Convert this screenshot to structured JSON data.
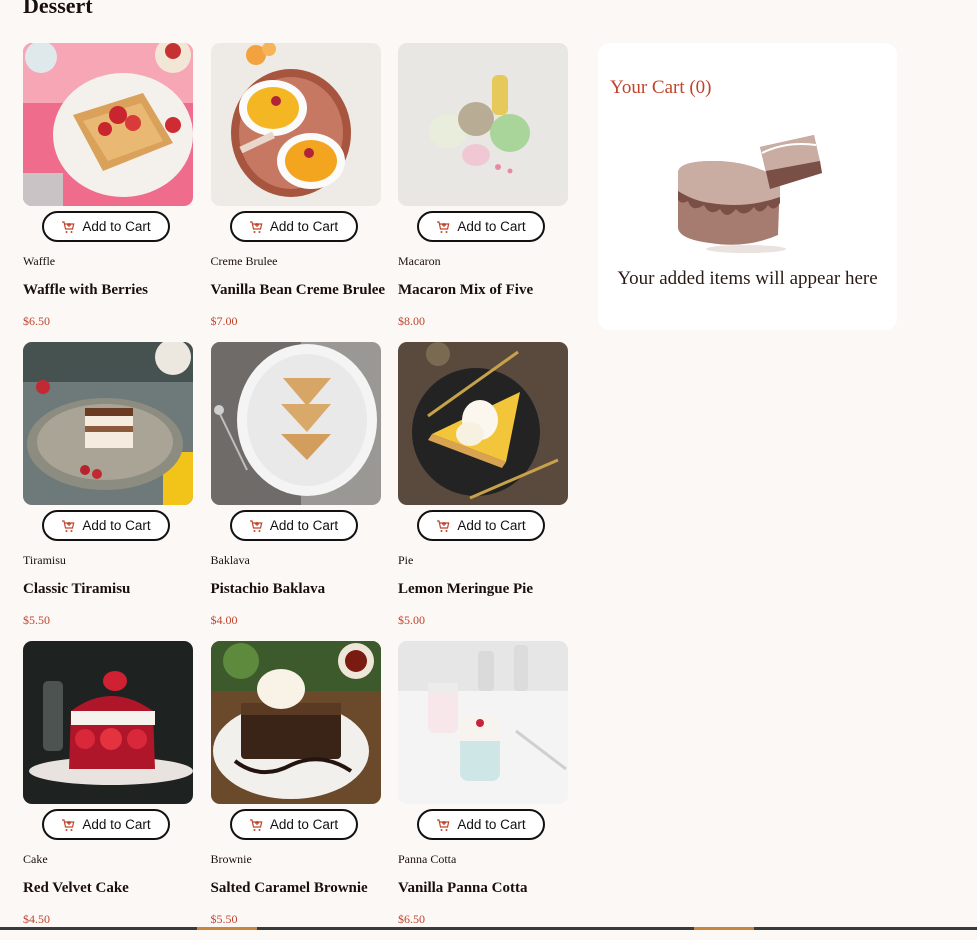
{
  "page": {
    "title": "Dessert"
  },
  "products": [
    {
      "category": "Waffle",
      "name": "Waffle with Berries",
      "price": "$6.50",
      "button": "Add to Cart",
      "image": "waffle"
    },
    {
      "category": "Creme Brulee",
      "name": "Vanilla Bean Creme Brulee",
      "price": "$7.00",
      "button": "Add to Cart",
      "image": "creme-brulee"
    },
    {
      "category": "Macaron",
      "name": "Macaron Mix of Five",
      "price": "$8.00",
      "button": "Add to Cart",
      "image": "macaron"
    },
    {
      "category": "Tiramisu",
      "name": "Classic Tiramisu",
      "price": "$5.50",
      "button": "Add to Cart",
      "image": "tiramisu"
    },
    {
      "category": "Baklava",
      "name": "Pistachio Baklava",
      "price": "$4.00",
      "button": "Add to Cart",
      "image": "baklava"
    },
    {
      "category": "Pie",
      "name": "Lemon Meringue Pie",
      "price": "$5.00",
      "button": "Add to Cart",
      "image": "pie"
    },
    {
      "category": "Cake",
      "name": "Red Velvet Cake",
      "price": "$4.50",
      "button": "Add to Cart",
      "image": "cake"
    },
    {
      "category": "Brownie",
      "name": "Salted Caramel Brownie",
      "price": "$5.50",
      "button": "Add to Cart",
      "image": "brownie"
    },
    {
      "category": "Panna Cotta",
      "name": "Vanilla Panna Cotta",
      "price": "$6.50",
      "button": "Add to Cart",
      "image": "panna-cotta"
    }
  ],
  "cart": {
    "title": "Your Cart (0)",
    "empty_message": "Your added items will appear here",
    "illustration": "empty-cake-illustration"
  },
  "colors": {
    "accent": "#c0442d",
    "background": "#fcf8f6",
    "card": "#ffffff",
    "text": "#1a0f0c"
  },
  "icons": {
    "add_to_cart": "add-to-cart-icon"
  }
}
